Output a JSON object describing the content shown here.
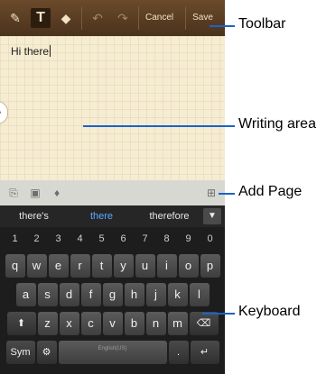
{
  "toolbar": {
    "cancel_label": "Cancel",
    "save_label": "Save",
    "icons": [
      "pen-icon",
      "text-icon",
      "eraser-icon",
      "undo-icon",
      "redo-icon"
    ]
  },
  "note": {
    "text": "Hi there"
  },
  "suggestions": [
    "there's",
    "there",
    "therefore"
  ],
  "keyboard": {
    "numbers": [
      "1",
      "2",
      "3",
      "4",
      "5",
      "6",
      "7",
      "8",
      "9",
      "0"
    ],
    "row1": [
      "q",
      "w",
      "e",
      "r",
      "t",
      "y",
      "u",
      "i",
      "o",
      "p"
    ],
    "row2": [
      "a",
      "s",
      "d",
      "f",
      "g",
      "h",
      "j",
      "k",
      "l"
    ],
    "row3": [
      "z",
      "x",
      "c",
      "v",
      "b",
      "n",
      "m"
    ],
    "sym_label": "Sym",
    "space_label": "English(US)"
  },
  "callouts": {
    "toolbar": "Toolbar",
    "writing_area": "Writing area",
    "add_page": "Add Page",
    "keyboard": "Keyboard"
  },
  "colors": {
    "accent": "#1a64c8",
    "paper": "#f6ecd2",
    "toolbar": "#5b3e23"
  }
}
